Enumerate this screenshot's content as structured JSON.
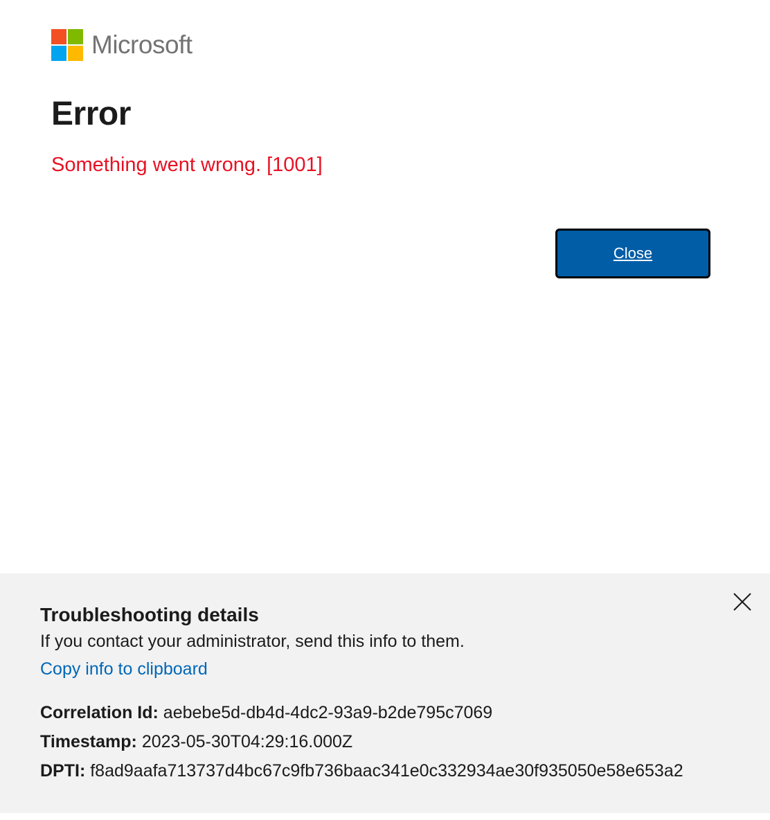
{
  "brand": {
    "name": "Microsoft",
    "logo_colors": [
      "#f25022",
      "#7fba00",
      "#00a4ef",
      "#ffb900"
    ]
  },
  "page": {
    "title": "Error",
    "message": "Something went wrong. [1001]"
  },
  "actions": {
    "close_label": "Close"
  },
  "troubleshooting": {
    "title": "Troubleshooting details",
    "description": "If you contact your administrator, send this info to them.",
    "copy_link": "Copy info to clipboard",
    "close_icon": "close-icon",
    "fields": [
      {
        "label": "Correlation Id:",
        "value": "aebebe5d-db4d-4dc2-93a9-b2de795c7069"
      },
      {
        "label": "Timestamp:",
        "value": "2023-05-30T04:29:16.000Z"
      },
      {
        "label": "DPTI:",
        "value": "f8ad9aafa713737d4bc67c9fb736baac341e0c332934ae30f935050e58e653a2"
      }
    ]
  },
  "colors": {
    "error_text": "#e81123",
    "button_bg": "#005da6",
    "link": "#0067b8",
    "panel_bg": "#f2f2f2"
  }
}
